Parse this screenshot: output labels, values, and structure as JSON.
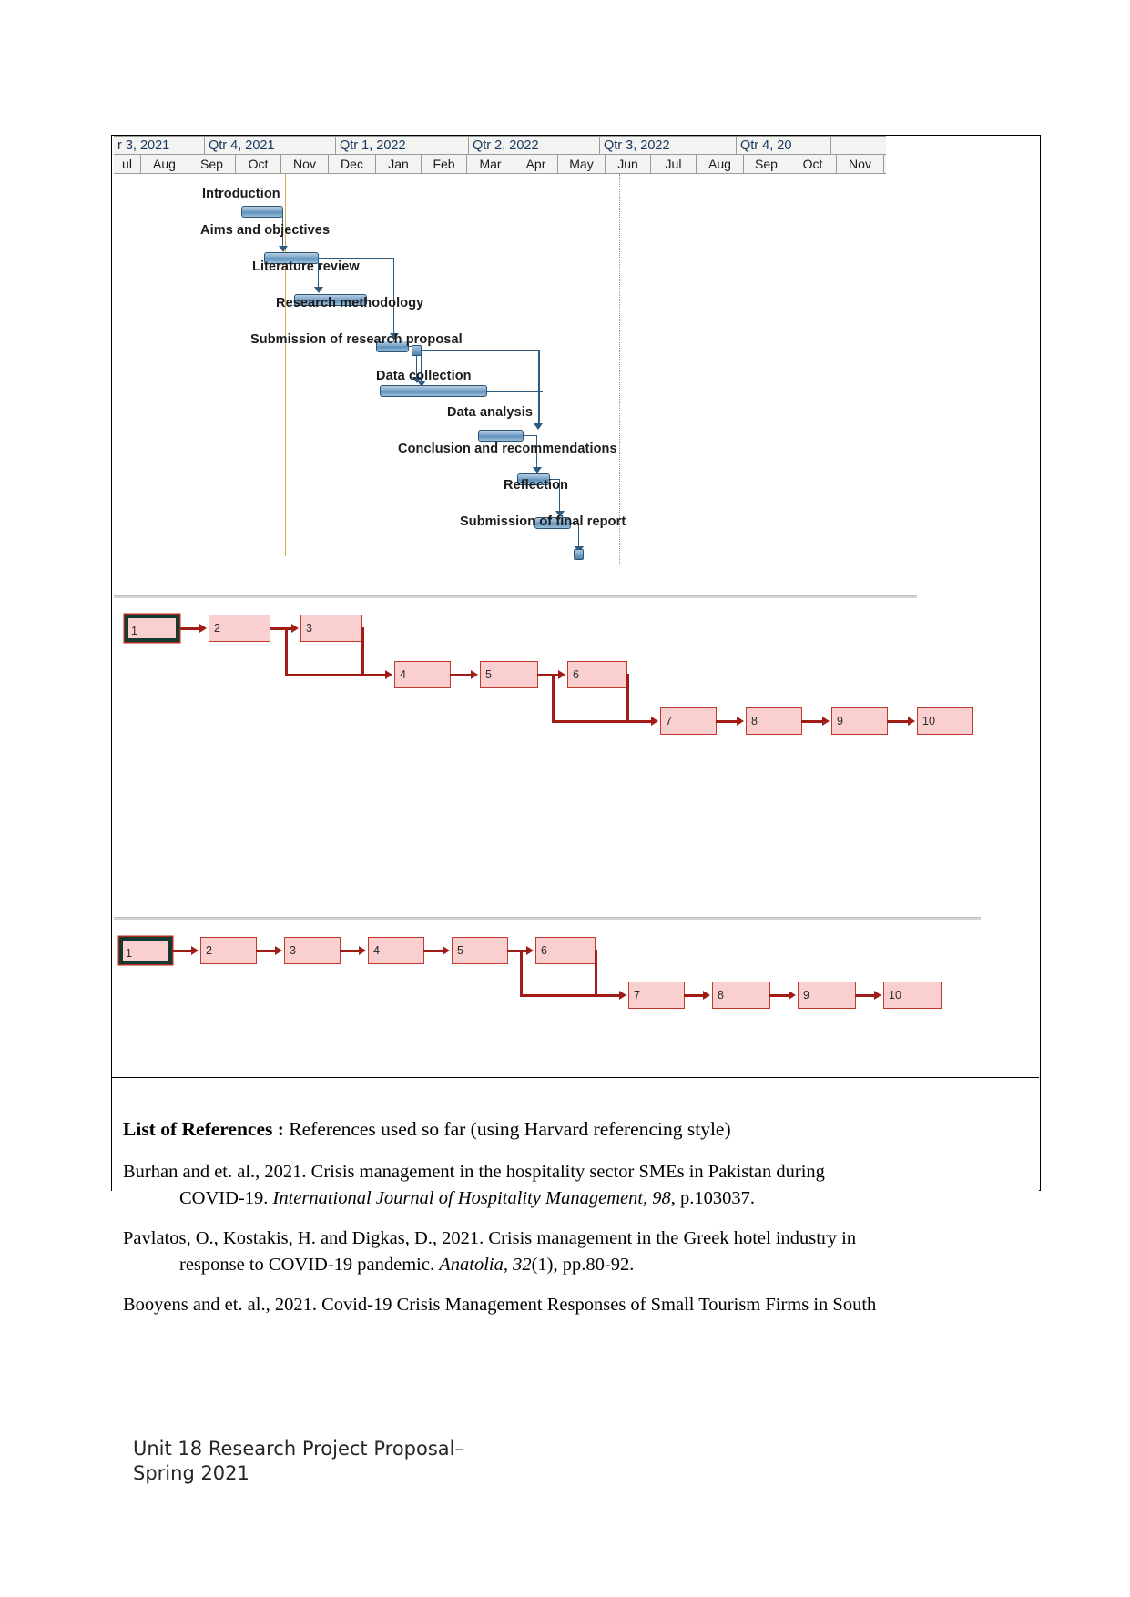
{
  "gantt": {
    "quarters": [
      {
        "label": "r 3, 2021",
        "months": 2
      },
      {
        "label": "Qtr 4, 2021",
        "months": 3
      },
      {
        "label": "Qtr 1, 2022",
        "months": 3
      },
      {
        "label": "Qtr 2, 2022",
        "months": 3
      },
      {
        "label": "Qtr 3, 2022",
        "months": 3
      },
      {
        "label": "Qtr 4, 20",
        "months": 2
      }
    ],
    "months": [
      "ul",
      "Aug",
      "Sep",
      "Oct",
      "Nov",
      "Dec",
      "Jan",
      "Feb",
      "Mar",
      "Apr",
      "May",
      "Jun",
      "Jul",
      "Aug",
      "Sep",
      "Oct",
      "Nov"
    ],
    "tasks": [
      {
        "name": "Introduction",
        "type": "bar"
      },
      {
        "name": "Aims and objectives",
        "type": "bar"
      },
      {
        "name": "Literature review",
        "type": "bar"
      },
      {
        "name": "Research methodology",
        "type": "bar"
      },
      {
        "name": "Submission of research proposal",
        "type": "milestone"
      },
      {
        "name": "Data collection",
        "type": "bar"
      },
      {
        "name": "Data analysis",
        "type": "bar"
      },
      {
        "name": "Conclusion and recommendations",
        "type": "bar"
      },
      {
        "name": "Reflection",
        "type": "bar"
      },
      {
        "name": "Submission of final report",
        "type": "milestone"
      }
    ]
  },
  "network_top": {
    "nodes": [
      "1",
      "2",
      "3",
      "4",
      "5",
      "6",
      "7",
      "8",
      "9",
      "10"
    ]
  },
  "network_bottom": {
    "nodes": [
      "1",
      "2",
      "3",
      "4",
      "5",
      "6",
      "7",
      "8",
      "9",
      "10"
    ]
  },
  "references": {
    "heading_bold": "List of References :",
    "heading_rest": " References used so far (using Harvard referencing style)",
    "items": [
      {
        "line1": "Burhan and et. al., 2021. Crisis management in the hospitality sector SMEs in Pakistan during",
        "line2_plain_a": "COVID-19. ",
        "line2_italic": "International Journal of Hospitality Management, 98",
        "line2_plain_b": ", p.103037."
      },
      {
        "line1": "Pavlatos, O., Kostakis, H. and Digkas, D., 2021. Crisis management in the Greek hotel industry in",
        "line2_plain_a": "response to COVID-19 pandemic. ",
        "line2_italic": "Anatolia, 32",
        "line2_plain_b": "(1), pp.80-92."
      },
      {
        "line1": "Booyens and et. al., 2021. Covid-19 Crisis Management Responses of Small Tourism Firms in South",
        "line2_plain_a": "",
        "line2_italic": "",
        "line2_plain_b": ""
      }
    ]
  },
  "footer": {
    "text": "Unit 18 Research Project Proposal–\nSpring 2021"
  },
  "colors": {
    "bar_fill": "#7fa7c9",
    "bar_border": "#2b5475",
    "node_fill": "#f9cfcf",
    "node_border": "#c0392b",
    "connector": "#a11c15",
    "status_line": "#e0a84e",
    "today_line": "#8d8d8d"
  }
}
